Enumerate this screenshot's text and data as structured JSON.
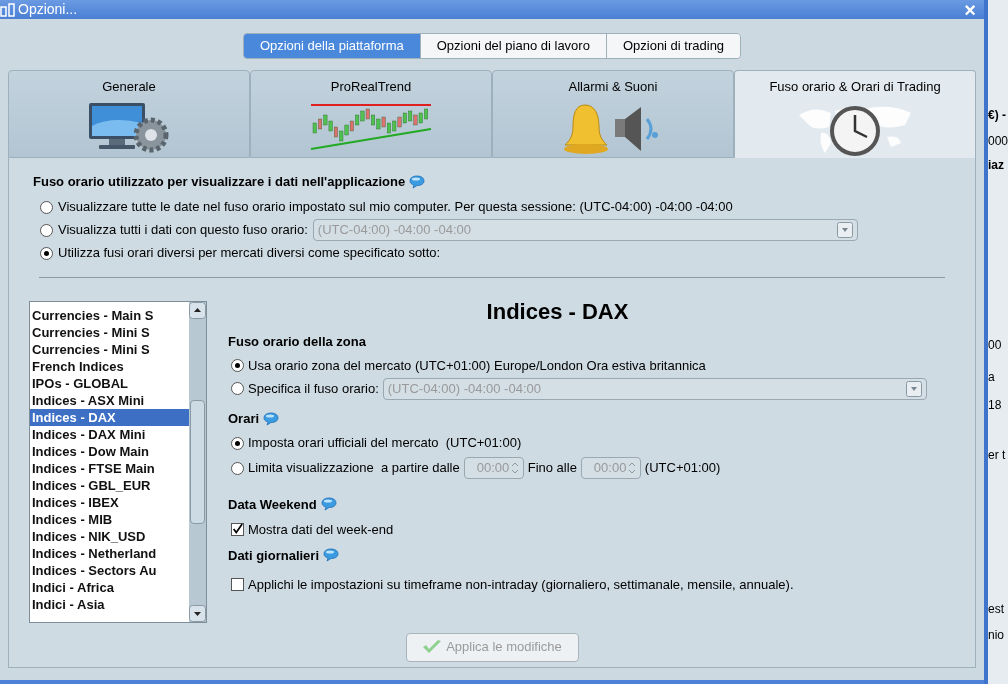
{
  "window": {
    "title": "Opzioni...",
    "close": "×"
  },
  "top_tabs": [
    {
      "label": "Opzioni della piattaforma",
      "selected": true
    },
    {
      "label": "Opzioni del piano di lavoro",
      "selected": false
    },
    {
      "label": "Opzioni di trading",
      "selected": false
    }
  ],
  "category_tabs": [
    {
      "label": "Generale",
      "kind": "computer",
      "selected": false
    },
    {
      "label": "ProRealTrend",
      "kind": "trend",
      "selected": false
    },
    {
      "label": "Allarmi & Suoni",
      "kind": "sound",
      "selected": false
    },
    {
      "label": "Fuso orario & Orari di Trading",
      "kind": "clock",
      "selected": true
    }
  ],
  "display_timezone": {
    "heading": "Fuso orario utilizzato per visualizzare i dati nell'applicazione",
    "options": [
      {
        "label": "Visualizzare tutte le date nel fuso orario impostato sul mio computer. Per questa sessione: (UTC-04:00) -04:00 -04:00",
        "selected": false
      },
      {
        "label": "Visualizza tutti i dati con questo fuso orario:",
        "selected": false,
        "dropdown": "(UTC-04:00) -04:00 -04:00"
      },
      {
        "label": "Utilizza fusi orari diversi per mercati diversi come specificato sotto:",
        "selected": true
      }
    ]
  },
  "markets": [
    {
      "label": "Currencies - Main S",
      "selected": false
    },
    {
      "label": "Currencies - Mini S",
      "selected": false
    },
    {
      "label": "Currencies - Mini S",
      "selected": false
    },
    {
      "label": "French Indices",
      "selected": false
    },
    {
      "label": "IPOs - GLOBAL",
      "selected": false
    },
    {
      "label": "Indices - ASX Mini",
      "selected": false
    },
    {
      "label": "Indices - DAX",
      "selected": true
    },
    {
      "label": "Indices - DAX Mini",
      "selected": false
    },
    {
      "label": "Indices - Dow Main",
      "selected": false
    },
    {
      "label": "Indices - FTSE Main",
      "selected": false
    },
    {
      "label": "Indices - GBL_EUR",
      "selected": false
    },
    {
      "label": "Indices - IBEX",
      "selected": false
    },
    {
      "label": "Indices - MIB",
      "selected": false
    },
    {
      "label": "Indices - NIK_USD",
      "selected": false
    },
    {
      "label": "Indices - Netherland",
      "selected": false
    },
    {
      "label": "Indices - Sectors Au",
      "selected": false
    },
    {
      "label": "Indici - Africa",
      "selected": false
    },
    {
      "label": "Indici - Asia",
      "selected": false
    }
  ],
  "detail": {
    "title": "Indices - DAX",
    "zone": {
      "heading": "Fuso orario della zona",
      "options": [
        {
          "label": "Usa orario zona del mercato (UTC+01:00) Europe/London Ora estiva britannica",
          "selected": true
        },
        {
          "label": "Specifica il fuso orario:",
          "selected": false,
          "dropdown": "(UTC-04:00) -04:00 -04:00"
        }
      ]
    },
    "hours": {
      "heading": "Orari",
      "options": [
        {
          "label": "Imposta orari ufficiali del mercato  (UTC+01:00)",
          "selected": true
        },
        {
          "label": "Limita visualizzazione  a partire dalle",
          "selected": false,
          "from": "00:00",
          "to_label": "Fino alle",
          "to": "00:00",
          "suffix": "(UTC+01:00)"
        }
      ]
    },
    "weekend": {
      "heading": "Data Weekend",
      "label": "Mostra dati del week-end",
      "checked": true
    },
    "daily": {
      "heading": "Dati giornalieri",
      "label": "Applichi le impostazioni su timeframe non-intraday (giornaliero, settimanale, mensile, annuale).",
      "checked": false
    }
  },
  "apply_button": {
    "label": "Applica le modifiche",
    "disabled": true
  },
  "background_window": [
    "€) -",
    "000",
    "iaz",
    "00",
    "a",
    "18",
    "er t",
    "est",
    "nio"
  ]
}
